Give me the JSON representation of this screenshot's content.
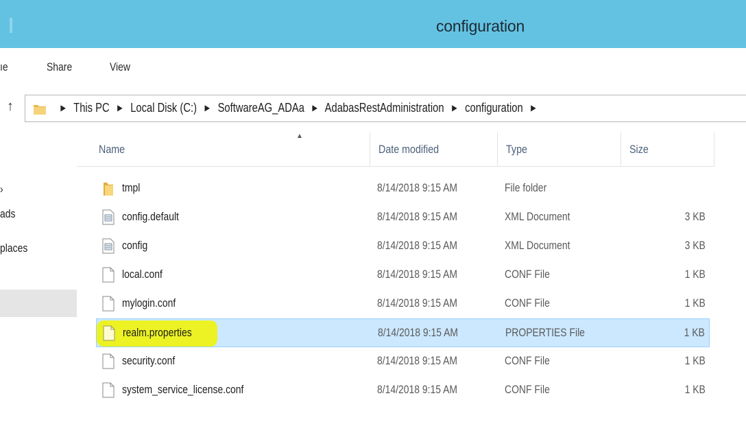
{
  "window": {
    "title": "configuration"
  },
  "ribbon": {
    "tabs": [
      "ıe",
      "Share",
      "View"
    ]
  },
  "address": {
    "crumbs": [
      "This PC",
      "Local Disk (C:)",
      "SoftwareAG_ADAa",
      "AdabasRestAdministration",
      "configuration"
    ]
  },
  "sidebar": {
    "items": [
      "›",
      "ads",
      "places"
    ]
  },
  "columns": {
    "name": "Name",
    "date": "Date modified",
    "type": "Type",
    "size": "Size"
  },
  "files": [
    {
      "name": "tmpl",
      "date": "8/14/2018 9:15 AM",
      "type": "File folder",
      "size": "",
      "icon": "folder-icon"
    },
    {
      "name": "config.default",
      "date": "8/14/2018 9:15 AM",
      "type": "XML Document",
      "size": "3 KB",
      "icon": "xml-file-icon"
    },
    {
      "name": "config",
      "date": "8/14/2018 9:15 AM",
      "type": "XML Document",
      "size": "3 KB",
      "icon": "xml-file-icon"
    },
    {
      "name": "local.conf",
      "date": "8/14/2018 9:15 AM",
      "type": "CONF File",
      "size": "1 KB",
      "icon": "file-icon"
    },
    {
      "name": "mylogin.conf",
      "date": "8/14/2018 9:15 AM",
      "type": "CONF File",
      "size": "1 KB",
      "icon": "file-icon"
    },
    {
      "name": "realm.properties",
      "date": "8/14/2018 9:15 AM",
      "type": "PROPERTIES File",
      "size": "1 KB",
      "icon": "file-icon"
    },
    {
      "name": "security.conf",
      "date": "8/14/2018 9:15 AM",
      "type": "CONF File",
      "size": "1 KB",
      "icon": "file-icon"
    },
    {
      "name": "system_service_license.conf",
      "date": "8/14/2018 9:15 AM",
      "type": "CONF File",
      "size": "1 KB",
      "icon": "file-icon"
    }
  ],
  "selection": {
    "selected_file": "realm.properties",
    "highlight_color": "#f0f30c",
    "selection_color": "#cce8ff"
  },
  "colors": {
    "titlebar": "#63c2e2",
    "header_text": "#4c607a"
  }
}
